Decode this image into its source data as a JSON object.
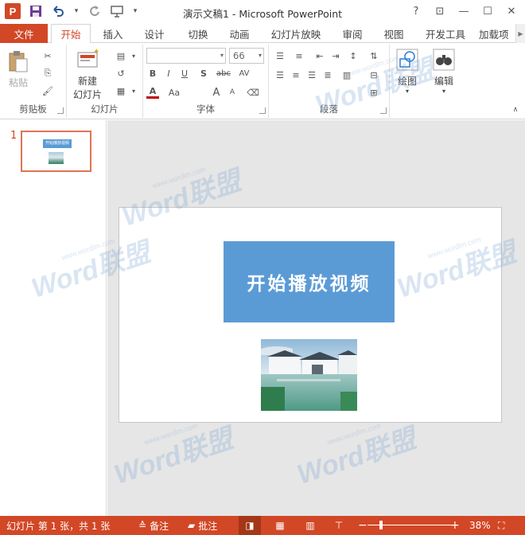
{
  "window": {
    "title": "演示文稿1 - Microsoft PowerPoint",
    "app_logo": "P",
    "controls": {
      "help": "?",
      "restore_ribbon": "⊡",
      "minimize": "—",
      "maximize": "☐",
      "close": "✕"
    }
  },
  "quick_access": {
    "save_icon": "save-icon",
    "undo_icon": "undo-icon",
    "redo_icon": "redo-icon",
    "present_icon": "present-from-start-icon",
    "customize": "▾"
  },
  "tabs": {
    "file": "文件",
    "items": [
      "开始",
      "插入",
      "设计",
      "切换",
      "动画",
      "幻灯片放映",
      "审阅",
      "视图",
      "开发工具",
      "加载项"
    ],
    "active": "开始"
  },
  "ribbon": {
    "clipboard": {
      "label": "剪贴板",
      "paste": "粘贴"
    },
    "slides": {
      "label": "幻灯片",
      "new_slide_line1": "新建",
      "new_slide_line2": "幻灯片"
    },
    "font": {
      "label": "字体",
      "font_name": "",
      "font_size": "66",
      "bold": "B",
      "italic": "I",
      "underline": "U",
      "shadow": "S",
      "strike": "abc",
      "spacing": "AV",
      "font_color": "A",
      "case": "Aa",
      "grow": "A",
      "shrink": "A"
    },
    "paragraph": {
      "label": "段落"
    },
    "drawing": {
      "label": "绘图"
    },
    "editing": {
      "label": "编辑"
    }
  },
  "thumbnails": [
    {
      "number": "1",
      "title": "开始播放视频"
    }
  ],
  "slide": {
    "title": "开始播放视频",
    "title_bg": "#5b9bd5"
  },
  "watermark": {
    "text": "Word联盟",
    "url": "www.wordlm.com"
  },
  "statusbar": {
    "slide_info": "幻灯片 第 1 张，共 1 张",
    "notes": "备注",
    "comments": "批注",
    "zoom_minus": "−",
    "zoom_plus": "+",
    "zoom_level": "38%",
    "zoom_fraction": 0.38,
    "bg_color": "#d24726"
  }
}
